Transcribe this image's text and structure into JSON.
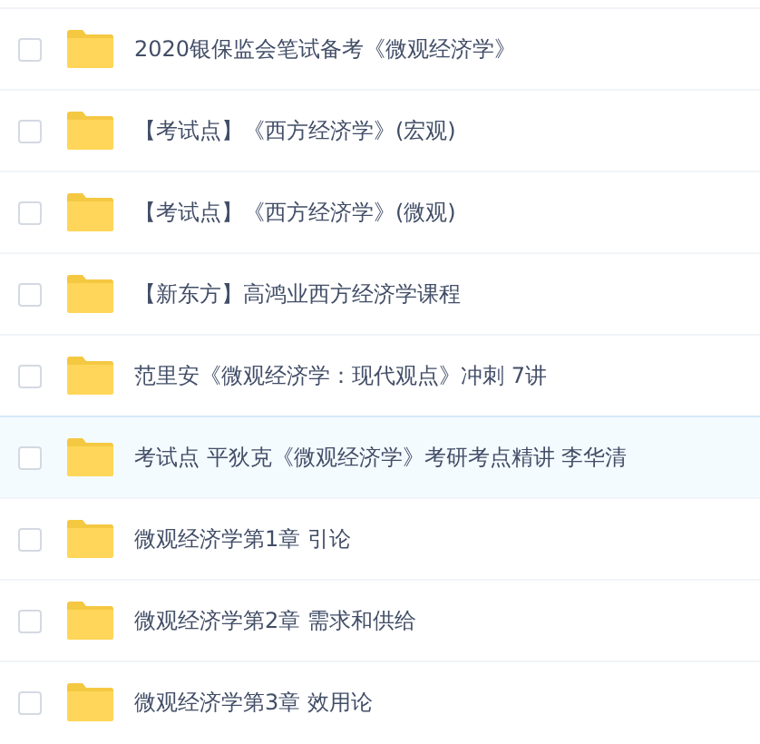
{
  "files": [
    {
      "name": "2020银保监会笔试备考《微观经济学》",
      "checked": false,
      "highlighted": false
    },
    {
      "name": "【考试点】《西方经济学》(宏观)",
      "checked": false,
      "highlighted": false
    },
    {
      "name": "【考试点】《西方经济学》(微观)",
      "checked": false,
      "highlighted": false
    },
    {
      "name": "【新东方】高鸿业西方经济学课程",
      "checked": false,
      "highlighted": false
    },
    {
      "name": "范里安《微观经济学：现代观点》冲刺 7讲",
      "checked": false,
      "highlighted": false
    },
    {
      "name": "考试点 平狄克《微观经济学》考研考点精讲 李华清",
      "checked": false,
      "highlighted": true
    },
    {
      "name": "微观经济学第1章 引论",
      "checked": false,
      "highlighted": false
    },
    {
      "name": "微观经济学第2章 需求和供给",
      "checked": false,
      "highlighted": false
    },
    {
      "name": "微观经济学第3章 效用论",
      "checked": false,
      "highlighted": false
    }
  ]
}
